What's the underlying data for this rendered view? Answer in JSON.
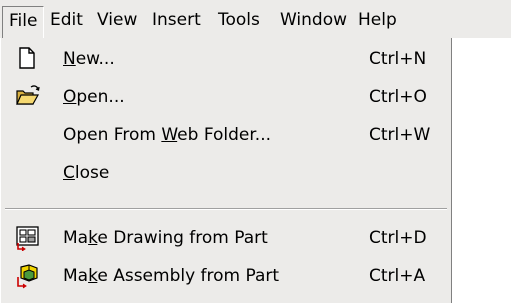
{
  "menubar": {
    "items": [
      {
        "label": "File"
      },
      {
        "label": "Edit"
      },
      {
        "label": "View"
      },
      {
        "label": "Insert"
      },
      {
        "label": "Tools"
      },
      {
        "label": "Window"
      },
      {
        "label": "Help"
      }
    ]
  },
  "file_menu": {
    "items": [
      {
        "pre": "",
        "accel": "N",
        "post": "ew...",
        "shortcut": "Ctrl+N",
        "icon": "new-document-icon"
      },
      {
        "pre": "",
        "accel": "O",
        "post": "pen...",
        "shortcut": "Ctrl+O",
        "icon": "open-folder-icon"
      },
      {
        "pre": "Open From ",
        "accel": "W",
        "post": "eb Folder...",
        "shortcut": "Ctrl+W",
        "icon": ""
      },
      {
        "pre": "",
        "accel": "C",
        "post": "lose",
        "shortcut": "",
        "icon": ""
      },
      {
        "pre": "Ma",
        "accel": "k",
        "post": "e Drawing from Part",
        "shortcut": "Ctrl+D",
        "icon": "make-drawing-icon"
      },
      {
        "pre": "Ma",
        "accel": "k",
        "post": "e Assembly from Part",
        "shortcut": "Ctrl+A",
        "icon": "make-assembly-icon"
      }
    ]
  },
  "colors": {
    "menu_bg": "#ecebe9",
    "separator": "#a0a0a0",
    "text": "#000000"
  }
}
